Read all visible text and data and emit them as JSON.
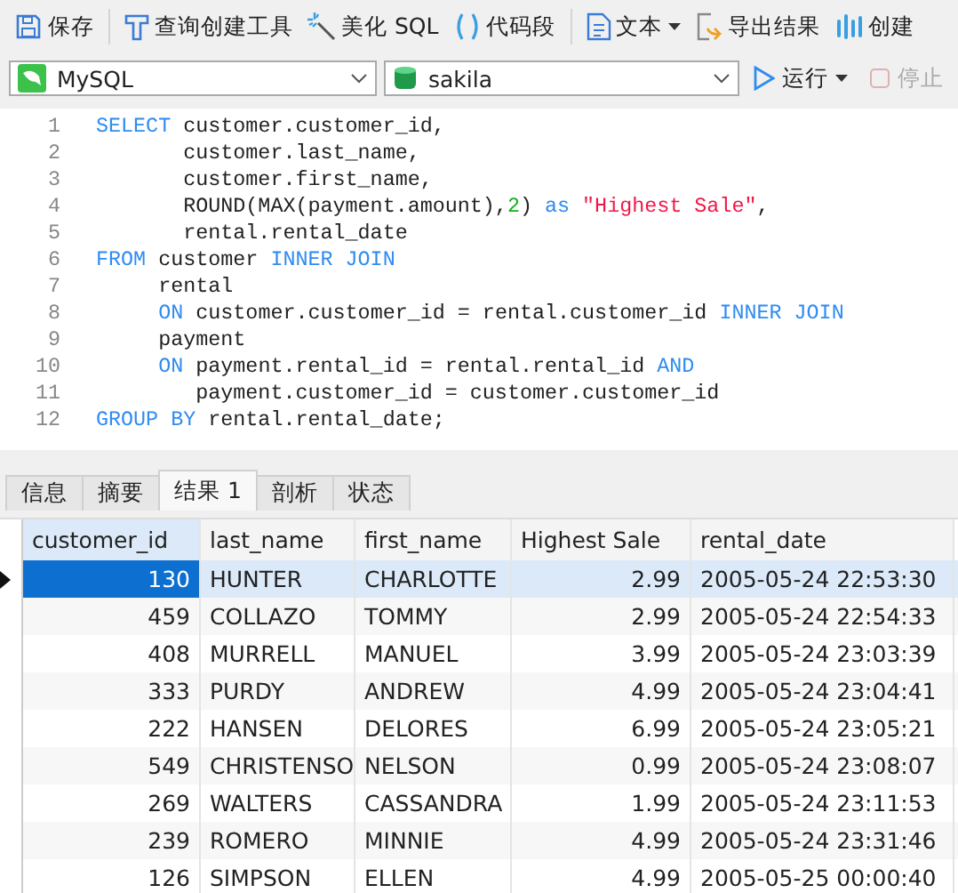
{
  "toolbar": {
    "buttons": [
      {
        "label": "保存",
        "dropdown": false
      },
      {
        "label": "查询创建工具",
        "dropdown": false
      },
      {
        "label": "美化 SQL",
        "dropdown": false
      },
      {
        "label": "代码段",
        "dropdown": false
      },
      {
        "label": "文本",
        "dropdown": true
      },
      {
        "label": "导出结果",
        "dropdown": false
      },
      {
        "label": "创建",
        "dropdown": false
      }
    ]
  },
  "connection": {
    "value": "MySQL"
  },
  "database": {
    "value": "sakila"
  },
  "run": {
    "label": "运行",
    "disabled": false
  },
  "stop": {
    "label": "停止",
    "disabled": true
  },
  "editor": {
    "lines": [
      {
        "number": "1",
        "tokens": [
          {
            "kind": "kw",
            "text": "SELECT"
          },
          {
            "kind": "plain",
            "text": " customer.customer_id,"
          }
        ]
      },
      {
        "number": "2",
        "tokens": [
          {
            "kind": "plain",
            "text": "       customer.last_name,"
          }
        ]
      },
      {
        "number": "3",
        "tokens": [
          {
            "kind": "plain",
            "text": "       customer.first_name,"
          }
        ]
      },
      {
        "number": "4",
        "tokens": [
          {
            "kind": "plain",
            "text": "       ROUND(MAX(payment.amount),"
          },
          {
            "kind": "num",
            "text": "2"
          },
          {
            "kind": "plain",
            "text": ") "
          },
          {
            "kind": "kw",
            "text": "as "
          },
          {
            "kind": "str",
            "text": "\"Highest Sale\""
          },
          {
            "kind": "plain",
            "text": ","
          }
        ]
      },
      {
        "number": "5",
        "tokens": [
          {
            "kind": "plain",
            "text": "       rental.rental_date"
          }
        ]
      },
      {
        "number": "6",
        "tokens": [
          {
            "kind": "kw",
            "text": "FROM"
          },
          {
            "kind": "plain",
            "text": " customer "
          },
          {
            "kind": "kw",
            "text": "INNER JOIN"
          }
        ]
      },
      {
        "number": "7",
        "tokens": [
          {
            "kind": "plain",
            "text": "     rental"
          }
        ]
      },
      {
        "number": "8",
        "tokens": [
          {
            "kind": "kw",
            "text": "     ON"
          },
          {
            "kind": "plain",
            "text": " customer.customer_id = rental.customer_id "
          },
          {
            "kind": "kw",
            "text": "INNER JOIN"
          }
        ]
      },
      {
        "number": "9",
        "tokens": [
          {
            "kind": "plain",
            "text": "     payment"
          }
        ]
      },
      {
        "number": "10",
        "tokens": [
          {
            "kind": "kw",
            "text": "     ON"
          },
          {
            "kind": "plain",
            "text": " payment.rental_id = rental.rental_id "
          },
          {
            "kind": "kw",
            "text": "AND"
          }
        ]
      },
      {
        "number": "11",
        "tokens": [
          {
            "kind": "plain",
            "text": "        payment.customer_id = customer.customer_id"
          }
        ]
      },
      {
        "number": "12",
        "tokens": [
          {
            "kind": "kw",
            "text": "GROUP BY"
          },
          {
            "kind": "plain",
            "text": " rental.rental_date;"
          }
        ]
      }
    ]
  },
  "result_tabs": [
    {
      "label": "信息",
      "selected": false
    },
    {
      "label": "摘要",
      "selected": false
    },
    {
      "label": "结果 1",
      "selected": true
    },
    {
      "label": "剖析",
      "selected": false
    },
    {
      "label": "状态",
      "selected": false
    }
  ],
  "table": {
    "columns": [
      {
        "label": "customer_id"
      },
      {
        "label": "last_name"
      },
      {
        "label": "first_name"
      },
      {
        "label": "Highest Sale"
      },
      {
        "label": "rental_date"
      }
    ],
    "rows": [
      {
        "selected": true,
        "cells": [
          "130",
          "HUNTER",
          "CHARLOTTE",
          "2.99",
          "2005-05-24 22:53:30"
        ]
      },
      {
        "selected": false,
        "cells": [
          "459",
          "COLLAZO",
          "TOMMY",
          "2.99",
          "2005-05-24 22:54:33"
        ]
      },
      {
        "selected": false,
        "cells": [
          "408",
          "MURRELL",
          "MANUEL",
          "3.99",
          "2005-05-24 23:03:39"
        ]
      },
      {
        "selected": false,
        "cells": [
          "333",
          "PURDY",
          "ANDREW",
          "4.99",
          "2005-05-24 23:04:41"
        ]
      },
      {
        "selected": false,
        "cells": [
          "222",
          "HANSEN",
          "DELORES",
          "6.99",
          "2005-05-24 23:05:21"
        ]
      },
      {
        "selected": false,
        "cells": [
          "549",
          "CHRISTENSO",
          "NELSON",
          "0.99",
          "2005-05-24 23:08:07"
        ]
      },
      {
        "selected": false,
        "cells": [
          "269",
          "WALTERS",
          "CASSANDRA",
          "1.99",
          "2005-05-24 23:11:53"
        ]
      },
      {
        "selected": false,
        "cells": [
          "239",
          "ROMERO",
          "MINNIE",
          "4.99",
          "2005-05-24 23:31:46"
        ]
      },
      {
        "selected": false,
        "cells": [
          "126",
          "SIMPSON",
          "ELLEN",
          "4.99",
          "2005-05-25 00:00:40"
        ]
      }
    ]
  }
}
